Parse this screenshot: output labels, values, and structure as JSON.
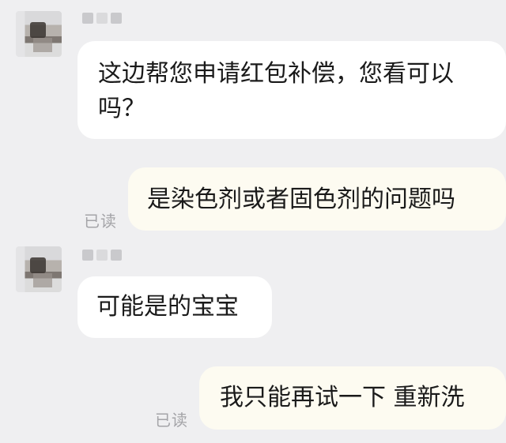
{
  "messages": [
    {
      "side": "in",
      "text_line1": "这边帮您申请红包补偿，您看可以",
      "text_line2": "吗？"
    },
    {
      "side": "out",
      "text": "是染色剂或者固色剂的问题吗",
      "status": "已读"
    },
    {
      "side": "in",
      "text": "可能是的宝宝"
    },
    {
      "side": "out",
      "text": "我只能再试一下 重新洗",
      "status": "已读"
    }
  ],
  "colors": {
    "background": "#efeff1",
    "incoming_bubble": "#ffffff",
    "outgoing_bubble": "#fdfbf1"
  }
}
